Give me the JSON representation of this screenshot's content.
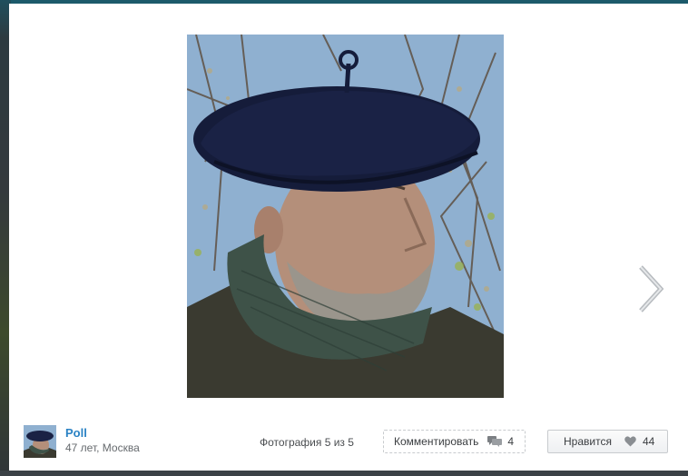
{
  "viewer": {
    "next_icon": "chevron-right-icon",
    "photo_alt": "Portrait photo"
  },
  "author": {
    "name": "Poll",
    "meta": "47 лет, Москва"
  },
  "photo_counter": "Фотография 5 из 5",
  "comment": {
    "label": "Комментировать",
    "count": "4",
    "icon": "comments-icon"
  },
  "like": {
    "label": "Нравится",
    "count": "44",
    "icon": "heart-icon"
  },
  "colors": {
    "link": "#2a82c4",
    "text_muted": "#666a6e",
    "border": "#c8cbce"
  }
}
